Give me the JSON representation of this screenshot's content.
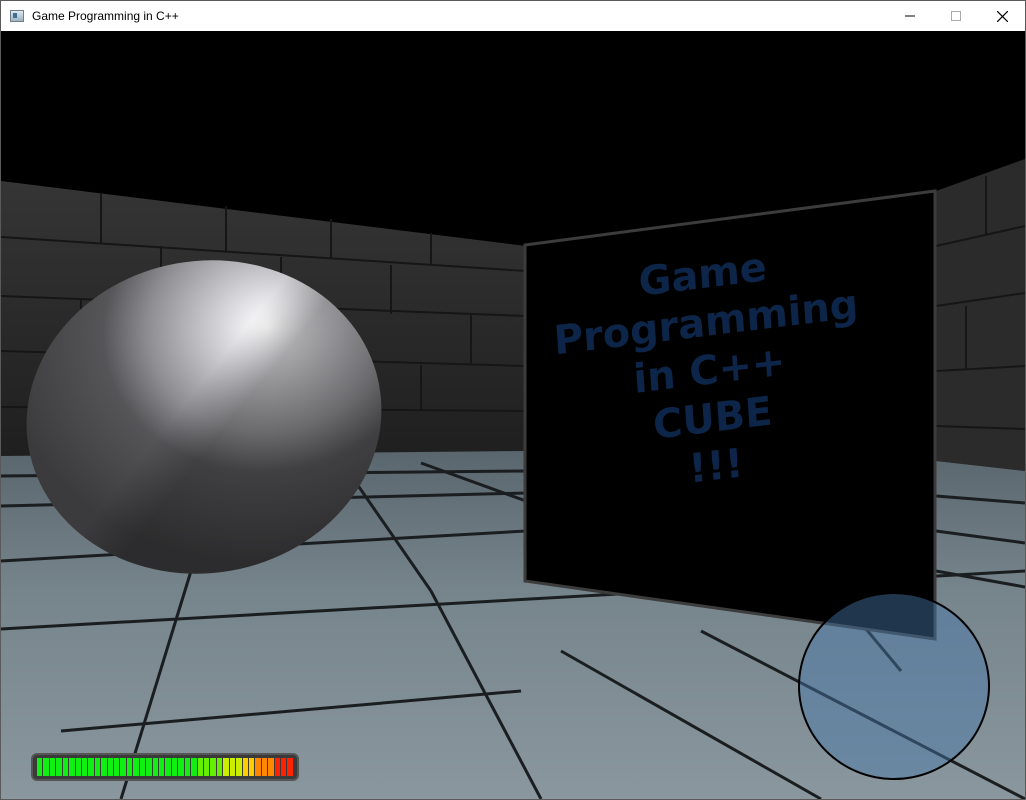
{
  "window": {
    "title": "Game Programming in C++",
    "controls": {
      "minimize_icon": "minimize-icon",
      "maximize_icon": "maximize-icon",
      "close_icon": "close-icon"
    }
  },
  "scene": {
    "sign_text": "Game\nProgramming\nin C++\nCUBE\n!!!",
    "sign_text_color": "#0d2548",
    "sphere_color": "#9a9a9a",
    "floor_color": "#6f7d85",
    "wall_color": "#2c2c2c"
  },
  "hud": {
    "health_fraction": 1.0,
    "health_colors": [
      "#00ff00",
      "#7fff00",
      "#ffd700",
      "#ff8c00",
      "#ff0000"
    ],
    "radar_color": "#4678aa"
  }
}
